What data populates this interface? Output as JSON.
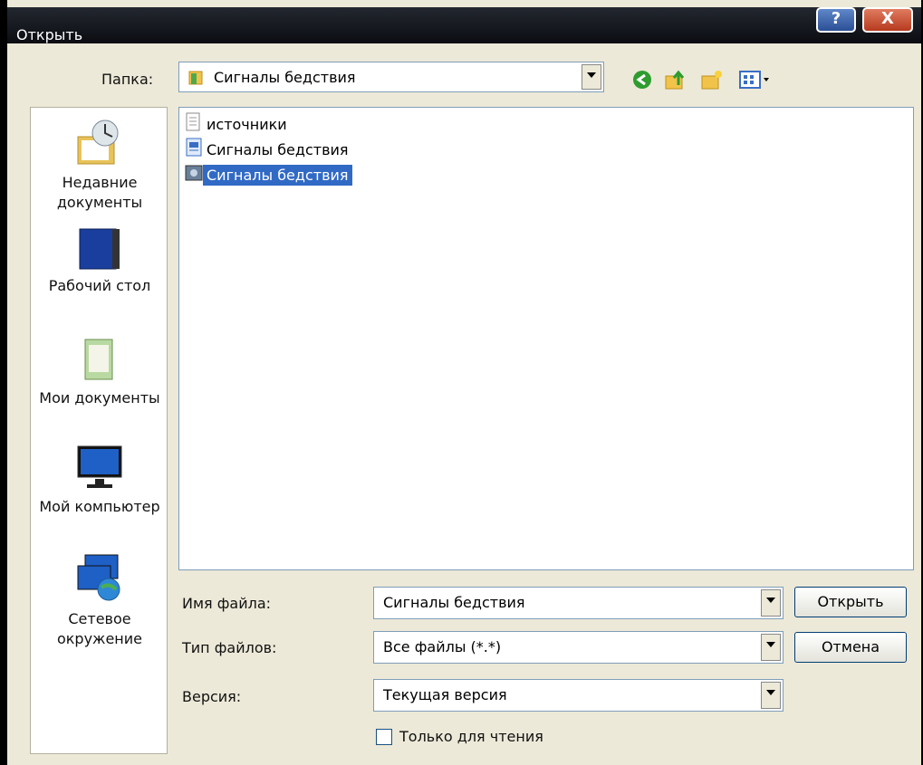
{
  "window": {
    "title": "Открыть",
    "help": "?",
    "close": "X"
  },
  "folder": {
    "label": "Папка:",
    "value": "Сигналы бедствия"
  },
  "places": [
    {
      "label": "Недавние документы"
    },
    {
      "label": "Рабочий стол"
    },
    {
      "label": "Мои документы"
    },
    {
      "label": "Мой компьютер"
    },
    {
      "label": "Сетевое окружение"
    }
  ],
  "files": [
    {
      "name": "источники",
      "icon": "document-icon",
      "selected": false
    },
    {
      "name": "Сигналы бедствия",
      "icon": "presentation-icon",
      "selected": false
    },
    {
      "name": "Сигналы бедствия",
      "icon": "media-icon",
      "selected": true
    }
  ],
  "filename": {
    "label": "Имя файла:",
    "value": "Сигналы бедствия"
  },
  "filetype": {
    "label": "Тип файлов:",
    "value": "Все файлы (*.*)"
  },
  "version": {
    "label": "Версия:",
    "value": "Текущая версия"
  },
  "readonly": {
    "label": "Только для чтения",
    "checked": false
  },
  "buttons": {
    "open": "Открыть",
    "cancel": "Отмена"
  }
}
